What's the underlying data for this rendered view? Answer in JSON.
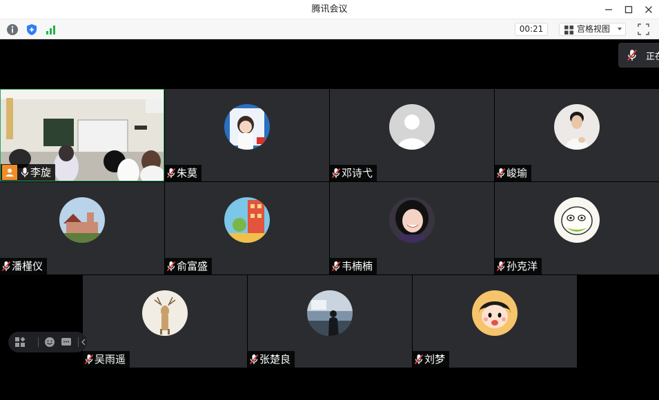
{
  "window": {
    "title": "腾讯会议",
    "controls": [
      "minimize-icon",
      "maximize-icon",
      "close-icon"
    ]
  },
  "toolbar": {
    "info_icon": "info-icon",
    "security_icon": "shield-icon",
    "network_icon": "signal-bars-icon",
    "timer": "00:21",
    "view_label": "宫格视图",
    "fullscreen_icon": "fullscreen-icon"
  },
  "speaking_indicator": {
    "text": "正在",
    "icon": "mic-muted-icon"
  },
  "participants": [
    {
      "name": "李旋",
      "mic": "on",
      "host": true,
      "video": true
    },
    {
      "name": "朱莫",
      "mic": "muted"
    },
    {
      "name": "邓诗弋",
      "mic": "muted"
    },
    {
      "name": "峻瑜",
      "mic": "muted"
    },
    {
      "name": "潘槿仪",
      "mic": "muted"
    },
    {
      "name": "俞富盛",
      "mic": "muted"
    },
    {
      "name": "韦楠楠",
      "mic": "muted"
    },
    {
      "name": "孙克洋",
      "mic": "muted"
    },
    {
      "name": "吴雨遥",
      "mic": "muted"
    },
    {
      "name": "张楚良",
      "mic": "muted"
    },
    {
      "name": "刘梦",
      "mic": "muted"
    }
  ],
  "floating_bar": {
    "icons": [
      "layout-icon",
      "emoji-icon",
      "chat-icon",
      "collapse-arrow-icon"
    ]
  },
  "colors": {
    "tile_bg": "#2b2c30",
    "active_border": "#26a45a",
    "host_badge": "#f28c28",
    "muted_mic": "#e03c3c"
  }
}
